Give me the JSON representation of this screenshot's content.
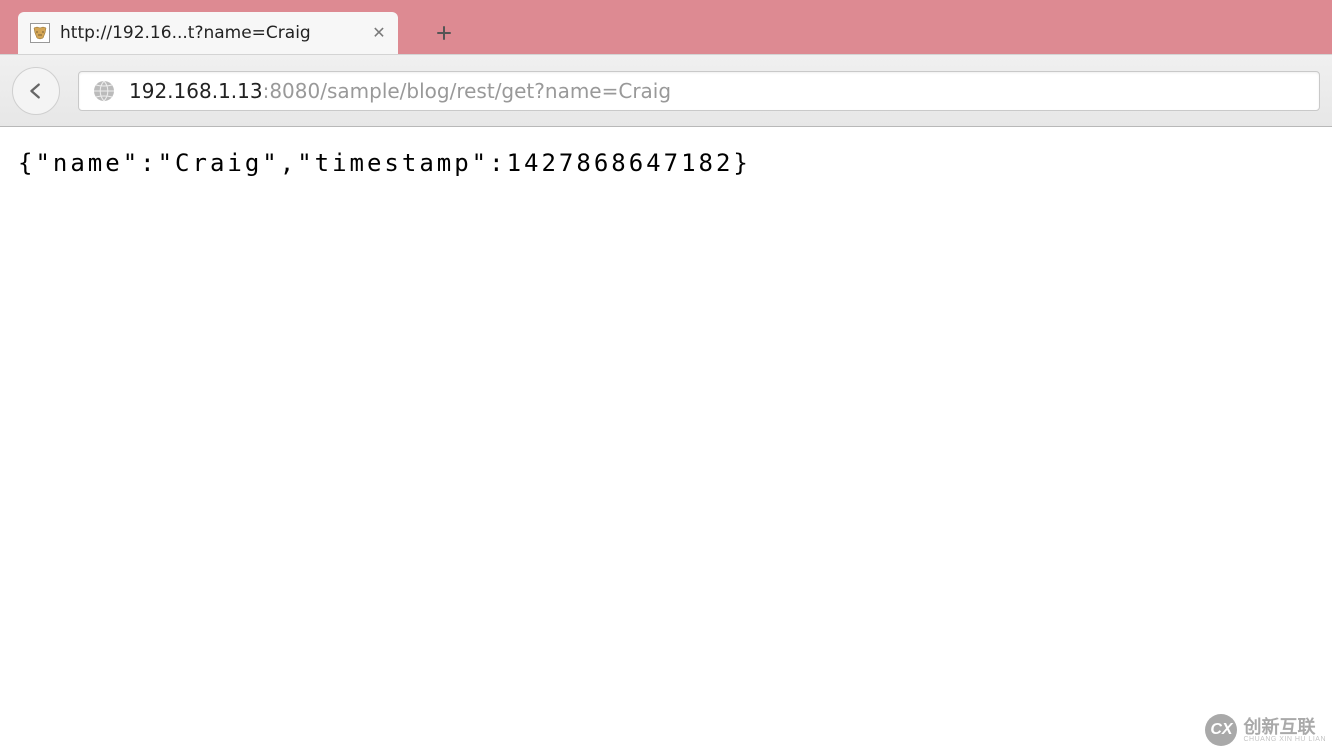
{
  "tab": {
    "title": "http://192.16...t?name=Craig",
    "favicon_name": "tomcat-favicon"
  },
  "toolbar": {
    "url_host": "192.168.1.13",
    "url_path": ":8080/sample/blog/rest/get?name=Craig"
  },
  "page": {
    "body_text": "{\"name\":\"Craig\",\"timestamp\":1427868647182}"
  },
  "watermark": {
    "logo_text": "CX",
    "main": "创新互联",
    "sub": "CHUANG XIN HU LIAN"
  }
}
